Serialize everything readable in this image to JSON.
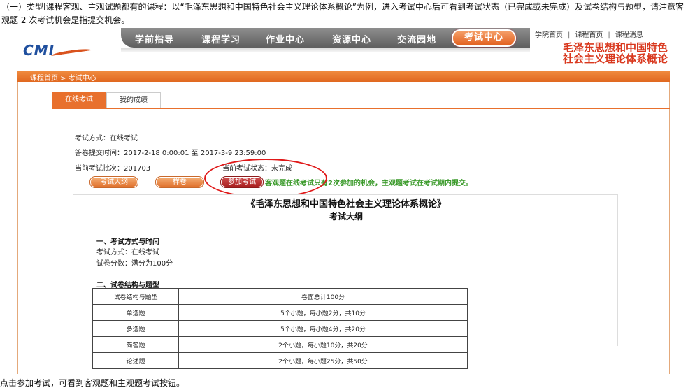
{
  "intro": "（一）类型Ⅰ课程客观、主观试题都有的课程：以“毛泽东思想和中国特色社会主义理论体系概论”为例，进入考试中心后可看到考试状态（已完成或未完成）及试卷结构与题型，请注意客观题 2 次考试机会是指提交机会。",
  "caption": "点击参加考试，可看到客观题和主观题考试按钮。",
  "header": {
    "logo_text": "CMI",
    "nav": [
      "学前指导",
      "课程学习",
      "作业中心",
      "资源中心",
      "交流园地"
    ],
    "nav_active": "考试中心",
    "toplinks": [
      "学院首页",
      "课程首页",
      "课程消息"
    ],
    "course_title_line1": "毛泽东思想和中国特色",
    "course_title_line2": "社会主义理论体系概论"
  },
  "breadcrumb": "课程首页 > 考试中心",
  "tabs": {
    "active": "在线考试",
    "inactive": "我的成绩"
  },
  "exam": {
    "mode": "考试方式：在线考试",
    "submit_time": "答卷提交时间：2017-2-18 0:00:01 至 2017-3-9 23:59:00",
    "batch": "当前考试批次：201703",
    "status": "当前考试状态：未完成",
    "btn_outline": "考试大纲",
    "btn_sample": "样卷",
    "btn_join": "参加考试",
    "notice": "客观题在线考试只有2次参加的机会，主观题考试在考试期内提交。"
  },
  "paper": {
    "title": "《毛泽东思想和中国特色社会主义理论体系概论》",
    "subtitle": "考试大纲",
    "section1": "一、考试方式与时间",
    "line1": "考试方式：在线考试",
    "line2": "试卷分数：满分为100分",
    "section2": "二、试卷结构与题型",
    "table": [
      [
        "试卷结构与题型",
        "卷面总计100分"
      ],
      [
        "单选题",
        "5个小题，每小题2分，共10分"
      ],
      [
        "多选题",
        "5个小题，每小题4分，共20分"
      ],
      [
        "简答题",
        "2个小题，每小题10分，共20分"
      ],
      [
        "论述题",
        "2个小题，每小题25分，共50分"
      ]
    ]
  },
  "colors": {
    "accent": "#e8702d",
    "title_red": "#d9381e",
    "notice_green": "#3a9a2a",
    "highlight_circle": "#e01818"
  }
}
